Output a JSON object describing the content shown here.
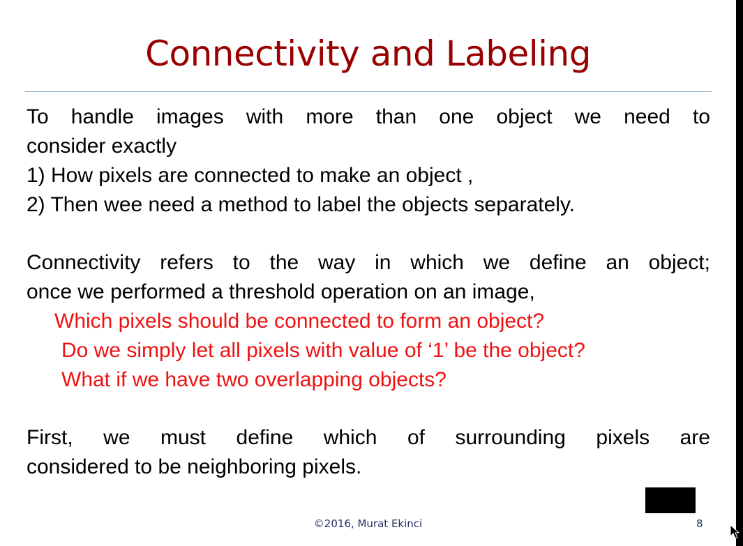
{
  "slide": {
    "title": "Connectivity and Labeling",
    "paragraph1": {
      "line1": "To handle images with more than one object we need to",
      "line2": "consider exactly",
      "line3": "1) How pixels are connected to make an object ,",
      "line4": "2) Then wee need a method to label the objects separately."
    },
    "paragraph2": {
      "line1": "Connectivity refers to the way in which we define an object;",
      "line2": "once we performed a threshold operation on an image,"
    },
    "questions": [
      "Which pixels should be connected to form an object?",
      "Do we simply let all pixels with value of ‘1’ be the object?",
      "What if we have two overlapping objects?"
    ],
    "paragraph3": {
      "line1": "First, we must define which of surrounding pixels are",
      "line2": "considered to be neighboring pixels."
    },
    "footer": "©2016, Murat Ekinci",
    "page_number": "8"
  },
  "colors": {
    "title": "#990000",
    "highlight": "#ee1111",
    "rule": "#7f9fc8",
    "footer": "#1f2f5f"
  },
  "icons": {
    "cursor": "mouse-pointer-icon"
  }
}
